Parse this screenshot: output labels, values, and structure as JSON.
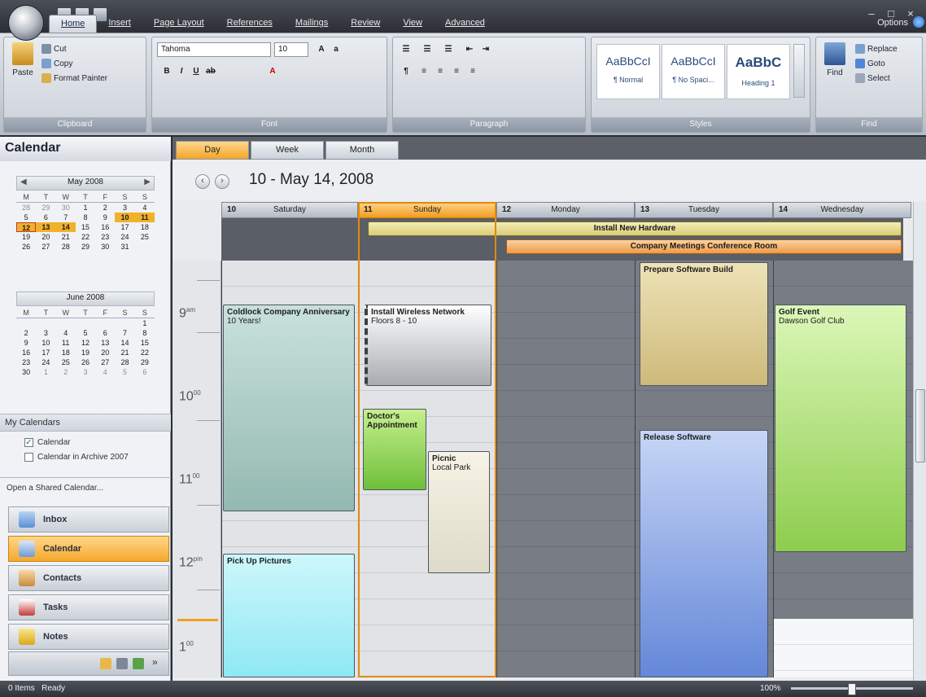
{
  "ribbon": {
    "tabs": [
      "Home",
      "Insert",
      "Page Layout",
      "References",
      "Mailings",
      "Review",
      "View",
      "Advanced"
    ],
    "active_tab": "Home",
    "options_label": "Options",
    "clipboard": {
      "paste": "Paste",
      "cut": "Cut",
      "copy": "Copy",
      "format_painter": "Format Painter",
      "label": "Clipboard"
    },
    "font": {
      "name": "Tahoma",
      "size": "10",
      "label": "Font"
    },
    "paragraph": {
      "label": "Paragraph"
    },
    "styles": {
      "label": "Styles",
      "items": [
        {
          "sample": "AaBbCcI",
          "name": "¶ Normal"
        },
        {
          "sample": "AaBbCcI",
          "name": "¶ No Spaci..."
        },
        {
          "sample": "AaBbC",
          "name": "Heading 1"
        }
      ]
    },
    "find": {
      "find": "Find",
      "replace": "Replace",
      "goto": "Goto",
      "select": "Select",
      "label": "Find"
    }
  },
  "nav": {
    "title": "Calendar",
    "may": {
      "title": "May 2008",
      "dow": [
        "M",
        "T",
        "W",
        "T",
        "F",
        "S",
        "S"
      ],
      "days": [
        "28",
        "29",
        "30",
        "1",
        "2",
        "3",
        "4",
        "5",
        "6",
        "7",
        "8",
        "9",
        "10",
        "11",
        "12",
        "13",
        "14",
        "15",
        "16",
        "17",
        "18",
        "19",
        "20",
        "21",
        "22",
        "23",
        "24",
        "25",
        "26",
        "27",
        "28",
        "29",
        "30",
        "31"
      ]
    },
    "june": {
      "title": "June 2008",
      "dow": [
        "M",
        "T",
        "W",
        "T",
        "F",
        "S",
        "S"
      ],
      "days": [
        "1",
        "2",
        "3",
        "4",
        "5",
        "6",
        "7",
        "8",
        "9",
        "10",
        "11",
        "12",
        "13",
        "14",
        "15",
        "16",
        "17",
        "18",
        "19",
        "20",
        "21",
        "22",
        "23",
        "24",
        "25",
        "26",
        "27",
        "28",
        "29",
        "30",
        "1",
        "2",
        "3",
        "4",
        "5",
        "6"
      ]
    },
    "my_calendars": "My Calendars",
    "calendars": [
      {
        "name": "Calendar",
        "checked": true
      },
      {
        "name": "Calendar in Archive 2007",
        "checked": false
      }
    ],
    "open_shared": "Open a Shared Calendar...",
    "buttons": [
      "Inbox",
      "Calendar",
      "Contacts",
      "Tasks",
      "Notes"
    ],
    "active_button": "Calendar"
  },
  "view": {
    "tabs": [
      "Day",
      "Week",
      "Month"
    ],
    "active_tab": "Day",
    "date_range": "10 - May 14, 2008",
    "days": [
      {
        "num": "10",
        "name": "Saturday"
      },
      {
        "num": "11",
        "name": "Sunday"
      },
      {
        "num": "12",
        "name": "Monday"
      },
      {
        "num": "13",
        "name": "Tuesday"
      },
      {
        "num": "14",
        "name": "Wednesday"
      }
    ],
    "allday_events": [
      {
        "title": "Install New Hardware"
      },
      {
        "title": "Company Meetings Conference Room"
      }
    ],
    "hours": [
      "9",
      "10",
      "11",
      "12",
      "1"
    ],
    "hour_suffix": [
      "am",
      "00",
      "00",
      "pm",
      "00"
    ],
    "events": [
      {
        "title": "Coldlock Company Anniversary",
        "detail": "10 Years!"
      },
      {
        "title": "Install Wireless Network",
        "detail": "Floors 8 - 10"
      },
      {
        "title": "Doctor's Appointment",
        "detail": ""
      },
      {
        "title": "Picnic",
        "detail": "Local Park"
      },
      {
        "title": "Pick Up Pictures",
        "detail": ""
      },
      {
        "title": "Prepare Software Build",
        "detail": ""
      },
      {
        "title": "Release Software",
        "detail": ""
      },
      {
        "title": "Golf Event",
        "detail": "Dawson Golf Club"
      }
    ]
  },
  "status": {
    "items": "0 Items",
    "ready": "Ready",
    "zoom": "100%"
  }
}
